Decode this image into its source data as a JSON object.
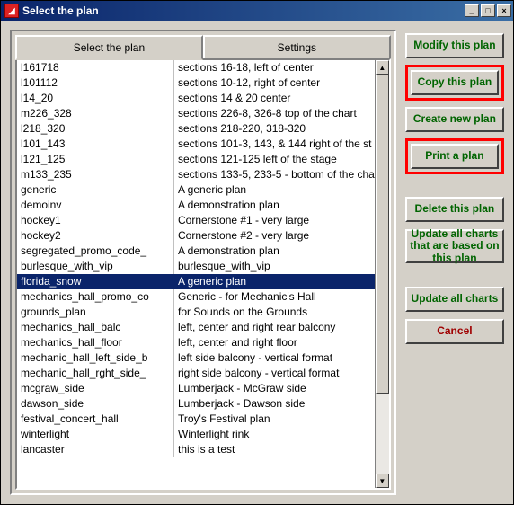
{
  "window": {
    "title": "Select the plan",
    "min": "_",
    "max": "□",
    "close": "×"
  },
  "tabs": {
    "select": "Select the plan",
    "settings": "Settings"
  },
  "plans": [
    {
      "name": "l161718",
      "desc": "sections 16-18, left of center",
      "selected": false
    },
    {
      "name": "l101112",
      "desc": "sections 10-12, right of center",
      "selected": false
    },
    {
      "name": "l14_20",
      "desc": "sections 14 & 20 center",
      "selected": false
    },
    {
      "name": "m226_328",
      "desc": "sections 226-8, 326-8 top of the chart",
      "selected": false
    },
    {
      "name": "l218_320",
      "desc": "sections 218-220, 318-320",
      "selected": false
    },
    {
      "name": "l101_143",
      "desc": "sections 101-3, 143, & 144 right of the st",
      "selected": false
    },
    {
      "name": "l121_125",
      "desc": "sections 121-125 left of the stage",
      "selected": false
    },
    {
      "name": "m133_235",
      "desc": "sections 133-5, 233-5 - bottom of the cha",
      "selected": false
    },
    {
      "name": "generic",
      "desc": "A generic plan",
      "selected": false
    },
    {
      "name": "demoinv",
      "desc": "A demonstration plan",
      "selected": false
    },
    {
      "name": "hockey1",
      "desc": "Cornerstone #1 - very large",
      "selected": false
    },
    {
      "name": "hockey2",
      "desc": "Cornerstone #2 - very large",
      "selected": false
    },
    {
      "name": "segregated_promo_code_",
      "desc": "A demonstration plan",
      "selected": false
    },
    {
      "name": "burlesque_with_vip",
      "desc": "burlesque_with_vip",
      "selected": false
    },
    {
      "name": "florida_snow",
      "desc": "A generic plan",
      "selected": true
    },
    {
      "name": "mechanics_hall_promo_co",
      "desc": "Generic - for Mechanic's Hall",
      "selected": false
    },
    {
      "name": "grounds_plan",
      "desc": "for Sounds on the Grounds",
      "selected": false
    },
    {
      "name": "mechanics_hall_balc",
      "desc": "left, center and right rear balcony",
      "selected": false
    },
    {
      "name": "mechanics_hall_floor",
      "desc": "left, center and right floor",
      "selected": false
    },
    {
      "name": "mechanic_hall_left_side_b",
      "desc": "left side balcony - vertical format",
      "selected": false
    },
    {
      "name": "mechanic_hall_rght_side_",
      "desc": "right side balcony - vertical format",
      "selected": false
    },
    {
      "name": "mcgraw_side",
      "desc": "Lumberjack - McGraw side",
      "selected": false
    },
    {
      "name": "dawson_side",
      "desc": "Lumberjack - Dawson side",
      "selected": false
    },
    {
      "name": "festival_concert_hall",
      "desc": "Troy's Festival plan",
      "selected": false
    },
    {
      "name": "winterlight",
      "desc": "Winterlight rink",
      "selected": false
    },
    {
      "name": "lancaster",
      "desc": "this is a test",
      "selected": false
    }
  ],
  "buttons": {
    "modify": "Modify this plan",
    "copy": "Copy this plan",
    "create": "Create new plan",
    "print": "Print a plan",
    "delete": "Delete this plan",
    "update_based": "Update all charts that are based on this plan",
    "update_all": "Update all charts",
    "cancel": "Cancel"
  }
}
